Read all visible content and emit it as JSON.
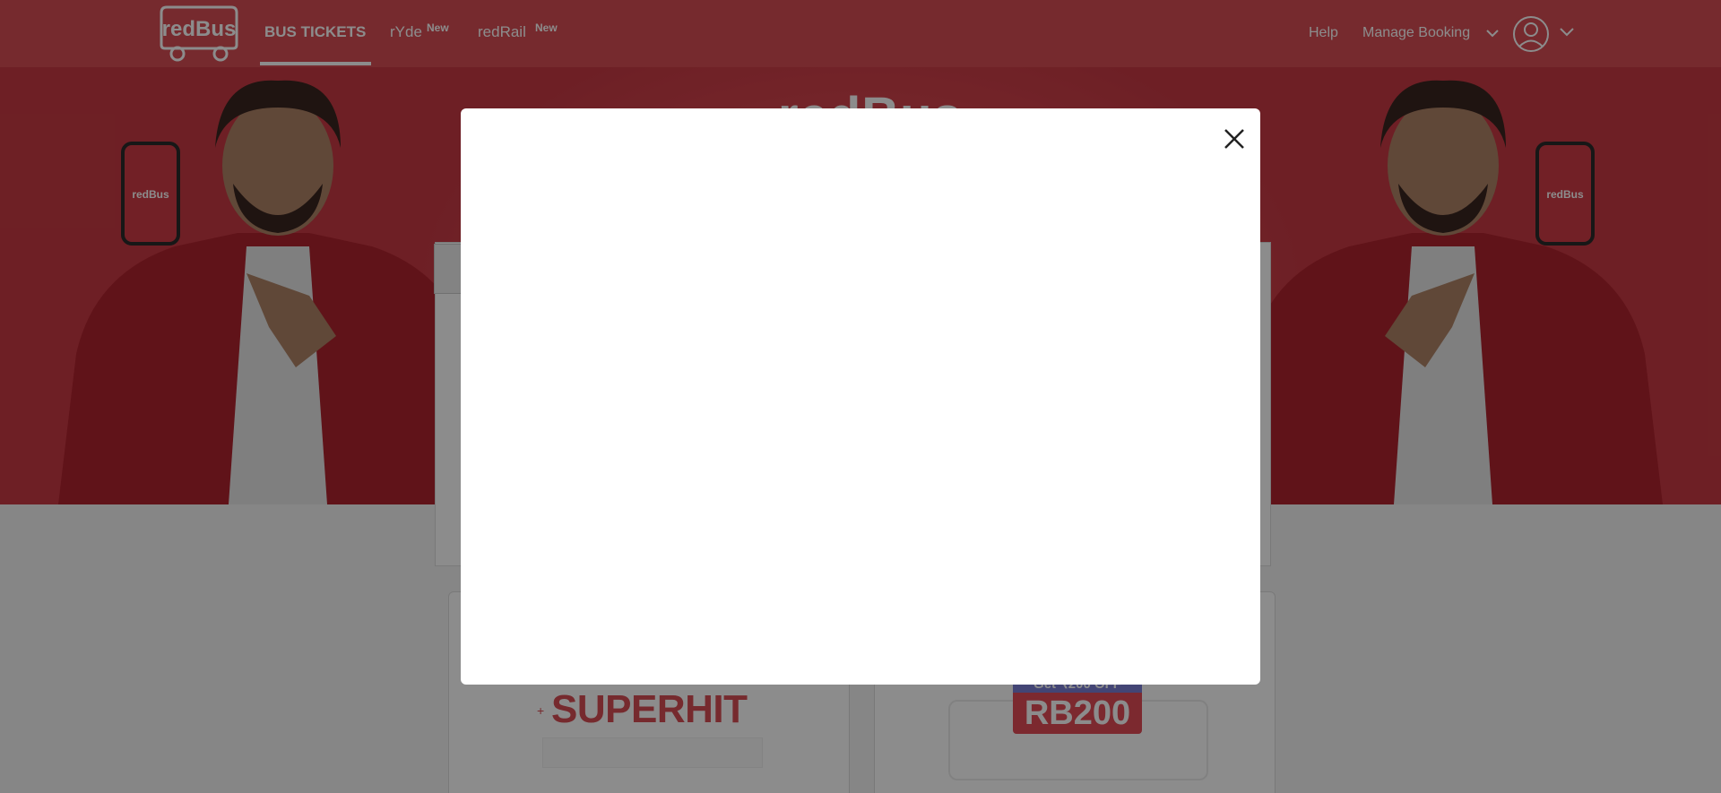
{
  "header": {
    "logo_text": "redBus",
    "nav": [
      {
        "label": "BUS TICKETS",
        "badge": ""
      },
      {
        "label": "rYde",
        "badge": "New"
      },
      {
        "label": "redRail",
        "badge": "New"
      }
    ],
    "help_label": "Help",
    "manage_booking_label": "Manage Booking"
  },
  "hero": {
    "brand_text": "redBus",
    "phone_logo_text": "redBus"
  },
  "offers": [
    {
      "headline": "SUPERHIT"
    },
    {
      "pill": "Get ₹200 OFF",
      "code": "RB200"
    }
  ],
  "modal": {
    "close_icon": "close-icon"
  },
  "colors": {
    "brand_red": "#d84e55",
    "overlay": "rgba(0,0,0,0.45)"
  }
}
